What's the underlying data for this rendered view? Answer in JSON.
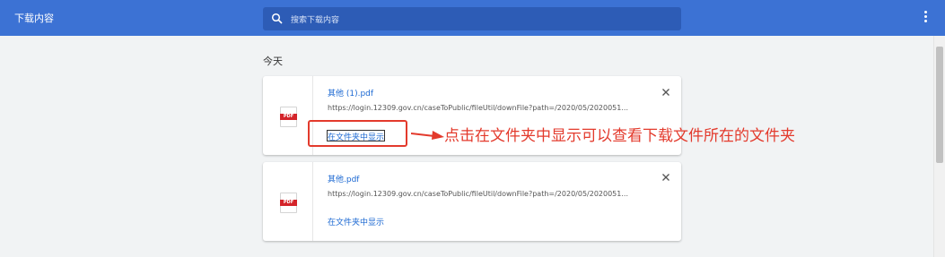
{
  "header": {
    "title": "下载内容",
    "search_placeholder": "搜索下载内容"
  },
  "section": {
    "label": "今天"
  },
  "downloads": [
    {
      "name": "其他 (1).pdf",
      "url": "https://login.12309.gov.cn/caseToPublic/fileUtil/downFile?path=/2020/05/2020051...",
      "show_in_folder": "在文件夹中显示",
      "icon_label": "PDF"
    },
    {
      "name": "其他.pdf",
      "url": "https://login.12309.gov.cn/caseToPublic/fileUtil/downFile?path=/2020/05/2020051...",
      "show_in_folder": "在文件夹中显示",
      "icon_label": "PDF"
    }
  ],
  "annotation": {
    "text": "点击在文件夹中显示可以查看下载文件所在的文件夹",
    "color": "#e33a2c"
  },
  "colors": {
    "header_bg": "#3c72d4",
    "link": "#1a67d2"
  }
}
